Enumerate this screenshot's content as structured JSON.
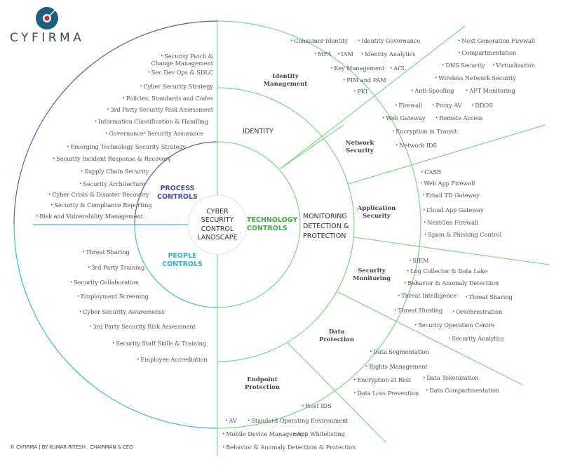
{
  "brand": {
    "name": "CYFIRMA",
    "logo_icon": "target-disc-icon",
    "colors": {
      "logo_blue": "#1d5f80",
      "logo_red": "#e0242b",
      "process": "#4a4aa8",
      "people": "#2bb5c2",
      "technology": "#3cb043",
      "line_green": "#7dd68a"
    }
  },
  "center": {
    "label": "CYBER\nSECURITY\nCONTROL\nLANDSCAPE"
  },
  "rings": {
    "process": "PROCESS\nCONTROLS",
    "people": "PEOPLE\nCONTROLS",
    "technology": "TECHNOLOGY\nCONTROLS",
    "identity": "IDENTITY",
    "monitoring": "MONITORING\nDETECTION &\nPROTECTION"
  },
  "segments": {
    "identity_management": "Identity\nManagement",
    "network_security": "Network\nSecurity",
    "application_security": "Application\nSecurity",
    "security_monitoring": "Security\nMonitoring",
    "data_protection": "Data\nProtection",
    "endpoint_protection": "Endpoint\nProtection"
  },
  "process_controls": [
    "Security Patch &\nChange Management",
    "Sec Dev Ops & SDLC",
    "Cyber Security Strategy",
    "Policies, Standards and Codes",
    "3rd Party Security Risk Assessment",
    "Information Classification & Handling",
    "Governance",
    "Security Assurance",
    "Emerging Technology Security Strategy",
    "Security Incident Response & Recovery",
    "Supply Chain Security",
    "Security Architecture",
    "Cyber Crisis & Disaster Recovery",
    "Security & Compliance Reporting",
    "Risk and Vulnerability Management"
  ],
  "people_controls": [
    "Threat Sharing",
    "3rd Party Training",
    "Security Collaboration",
    "Employment Screening",
    "Cyber Security Awaremenss",
    "3rd Party Security Risk Assessment",
    "Security Staff Skills & Training",
    "Employee Accrediation"
  ],
  "identity_management": [
    "Consumer Identity",
    "Identity Governance",
    "MFA",
    "IAM",
    "Identity Analytics",
    "Key Management",
    "ACL",
    "PIM and PAM",
    "PKI"
  ],
  "network_security": [
    "Next Generation  Firewall",
    "Compartmentation",
    "DNS Security",
    "Virtualization",
    "Wireless Network Security",
    "Anti-Spoofing",
    "APT Monitoring",
    "Firewall",
    "Proxy AV",
    "DDOS",
    "Web Gateway",
    "Remote Access",
    "Encryption in Transit",
    "Network IDS"
  ],
  "application_security": [
    "CASB",
    "Web App Firewall",
    "Email TD Gateway",
    "Cloud App Gateway",
    "NextGen Firewall",
    "Spam & Phishing Control"
  ],
  "security_monitoring": [
    "SIEM",
    "Log Collector & Data Lake",
    "Behavior & Anomaly Detectiion",
    "Threat Intelligence",
    "Threat Sharing",
    "Threat Hunting",
    "Orechrestration",
    "Security Operation Centre",
    "Security Analytics"
  ],
  "data_protection": [
    "Data Segmentation",
    "Rights Management",
    "Encryption at Rest",
    "Data Tokenization",
    "Data Loss Prevention",
    "Data Compartmentation"
  ],
  "endpoint_protection": [
    "Host IDS",
    "AV",
    "Standard Operating Environment",
    "Mobile Device Management",
    "App Whitelisting",
    "Behavior & Anomaly Detectiion & Protection"
  ],
  "footer": "© CYFIRMA | BY KUMAR RITESH , CHAIRMAN & CEO"
}
